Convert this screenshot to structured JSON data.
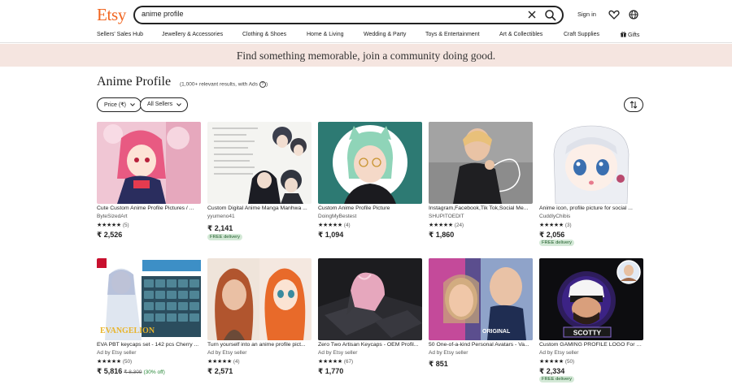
{
  "header": {
    "logo": "Etsy",
    "search_value": "anime profile",
    "signin_label": "Sign in"
  },
  "nav": [
    "Sellers' Sales Hub",
    "Jewellery & Accessories",
    "Clothing & Shoes",
    "Home & Living",
    "Wedding & Party",
    "Toys & Entertainment",
    "Art & Collectibles",
    "Craft Supplies",
    "Gifts"
  ],
  "banner": "Find something memorable, join a community doing good.",
  "results": {
    "title": "Anime Profile",
    "meta": "(1,000+ relevant results, with Ads",
    "filters": [
      "Price (₹)",
      "All Sellers"
    ]
  },
  "listings": [
    {
      "title": "Cute Custom Anime Profile Pictures / ...",
      "seller": "ByteSizedArt",
      "stars": "★★★★★",
      "count": "(5)",
      "price": "₹ 2,526",
      "orig": "",
      "disc": "",
      "badge": ""
    },
    {
      "title": "Custom Digital Anime Manga Manhwa ...",
      "seller": "yyumeno41",
      "stars": "",
      "count": "",
      "price": "₹ 2,141",
      "orig": "",
      "disc": "",
      "badge": "FREE delivery"
    },
    {
      "title": "Custom Anime Profile Picture",
      "seller": "DoingMyBestest",
      "stars": "★★★★★",
      "count": "(4)",
      "price": "₹ 1,094",
      "orig": "",
      "disc": "",
      "badge": ""
    },
    {
      "title": "Instagram,Facebook,Tik Tok,Social Me...",
      "seller": "SHUPITOEDIT",
      "stars": "★★★★★",
      "count": "(24)",
      "price": "₹ 1,860",
      "orig": "",
      "disc": "",
      "badge": ""
    },
    {
      "title": "Anime icon, profile picture for social ...",
      "seller": "CuddlyChibis",
      "stars": "★★★★★",
      "count": "(3)",
      "price": "₹ 2,056",
      "orig": "",
      "disc": "",
      "badge": "FREE delivery"
    },
    {
      "title": "EVA PBT keycaps set - 142 pcs Cherry ...",
      "seller": "Ad by Etsy seller",
      "stars": "★★★★★",
      "count": "(50)",
      "price": "₹ 5,816",
      "orig": "₹ 8,309",
      "disc": "(30% off)",
      "badge": ""
    },
    {
      "title": "Turn yourself into an anime profile pict...",
      "seller": "Ad by Etsy seller",
      "stars": "★★★★★",
      "count": "(4)",
      "price": "₹ 2,571",
      "orig": "",
      "disc": "",
      "badge": ""
    },
    {
      "title": "Zero Two Artisan Keycaps - OEM Profil...",
      "seller": "Ad by Etsy seller",
      "stars": "★★★★★",
      "count": "(67)",
      "price": "₹ 1,770",
      "orig": "",
      "disc": "",
      "badge": ""
    },
    {
      "title": "50 One-of-a-kind Personal Avatars - Va...",
      "seller": "Ad by Etsy seller",
      "stars": "",
      "count": "",
      "price": "₹ 851",
      "orig": "",
      "disc": "",
      "badge": ""
    },
    {
      "title": "Custom GAMING PROFILE LOGO For Y...",
      "seller": "Ad by Etsy seller",
      "stars": "★★★★★",
      "count": "(50)",
      "price": "₹ 2,334",
      "orig": "",
      "disc": "",
      "badge": "FREE delivery"
    }
  ],
  "image_text": {
    "keycap_brand": "EVANGELION",
    "avatar_caption": "ORIGINAL",
    "gaming_name": "SCOTTY"
  },
  "colors": {
    "brand": "#f1641e",
    "banner_bg": "#f5e5e0",
    "badge_bg": "#d4e9d7"
  }
}
